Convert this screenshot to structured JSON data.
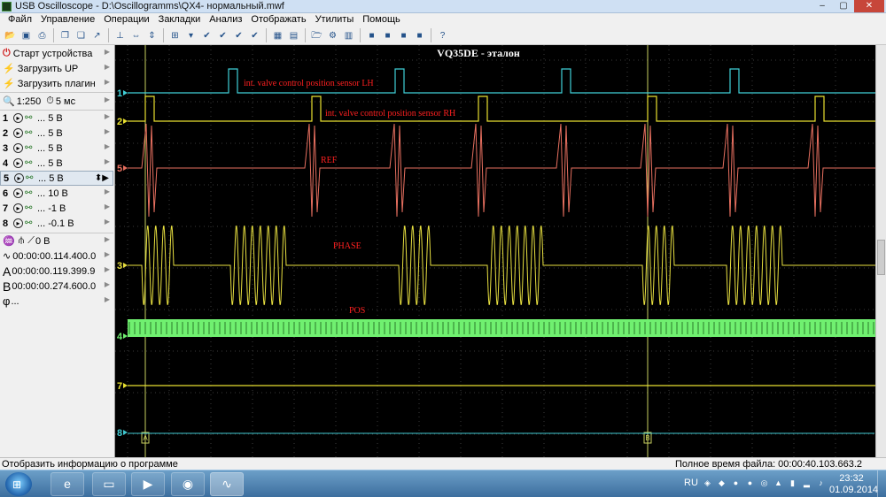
{
  "window": {
    "title": "USB Oscilloscope - D:\\Oscillogramms\\QX4- нормальный.mwf",
    "minimize": "–",
    "maximize": "▢",
    "close": "✕"
  },
  "menu": [
    "Файл",
    "Управление",
    "Операции",
    "Закладки",
    "Анализ",
    "Отображать",
    "Утилиты",
    "Помощь"
  ],
  "toolbar_icons": [
    "open-icon",
    "save-icon",
    "print-icon",
    "copy-icon",
    "paste-icon",
    "export-icon",
    "measure-icon",
    "cursor-icon",
    "zoom-icon",
    "marker-icon",
    "check-icon",
    "check2-icon",
    "check3-icon",
    "check4-icon",
    "grid-icon",
    "grid2-icon",
    "folder-icon",
    "settings-icon",
    "layout-icon",
    "stop-icon",
    "stop2-icon",
    "stop3-icon",
    "stop4-icon",
    "help-icon"
  ],
  "left_panel": {
    "start": "Старт устройства",
    "load_up": "Загрузить UP",
    "load_plugin": "Загрузить плагин",
    "zoom": "1:250",
    "timebase": "5 мс",
    "channels": [
      {
        "num": "1",
        "scale": "... 5 В"
      },
      {
        "num": "2",
        "scale": "... 5 В"
      },
      {
        "num": "3",
        "scale": "... 5 В"
      },
      {
        "num": "4",
        "scale": "... 5 В"
      },
      {
        "num": "5",
        "scale": "... 5 В"
      },
      {
        "num": "6",
        "scale": "... 10 В"
      },
      {
        "num": "7",
        "scale": "... -1 В"
      },
      {
        "num": "8",
        "scale": "... -0.1 В"
      }
    ],
    "trigger": "0 В",
    "cursor_t": "00:00:00.114.400.0",
    "cursor_a": "00:00:00.119.399.9",
    "cursor_b": "00:00:00.274.600.0",
    "cursor_a_label": "A",
    "cursor_b_label": "B",
    "phi_label": "φ",
    "phi_value": "..."
  },
  "scope": {
    "title": "VQ35DE - эталон",
    "labels": {
      "lh": "int. valve control position sensor LH",
      "rh": "int. valve control position sensor RH",
      "ref": "REF",
      "phase": "PHASE",
      "pos": "POS"
    },
    "channel_markers": [
      "1",
      "2",
      "5",
      "3",
      "4",
      "7",
      "8"
    ],
    "cursor_tags": [
      "A",
      "B"
    ],
    "colors": {
      "ch1": "#40d0d8",
      "ch2": "#e8e030",
      "ch5": "#e87060",
      "ch3": "#e8e040",
      "ch4": "#70f070",
      "ch7": "#e8e030",
      "ch8": "#40c8d0",
      "label": "#ff2020",
      "grid": "#3a3a3a",
      "cursor": "#c8d060"
    }
  },
  "status": {
    "left": "Отобразить информацию о программе",
    "right": "Полное время файла: 00:00:40.103.663.2"
  },
  "taskbar": {
    "lang": "RU",
    "time": "23:32",
    "date": "01.09.2014"
  }
}
